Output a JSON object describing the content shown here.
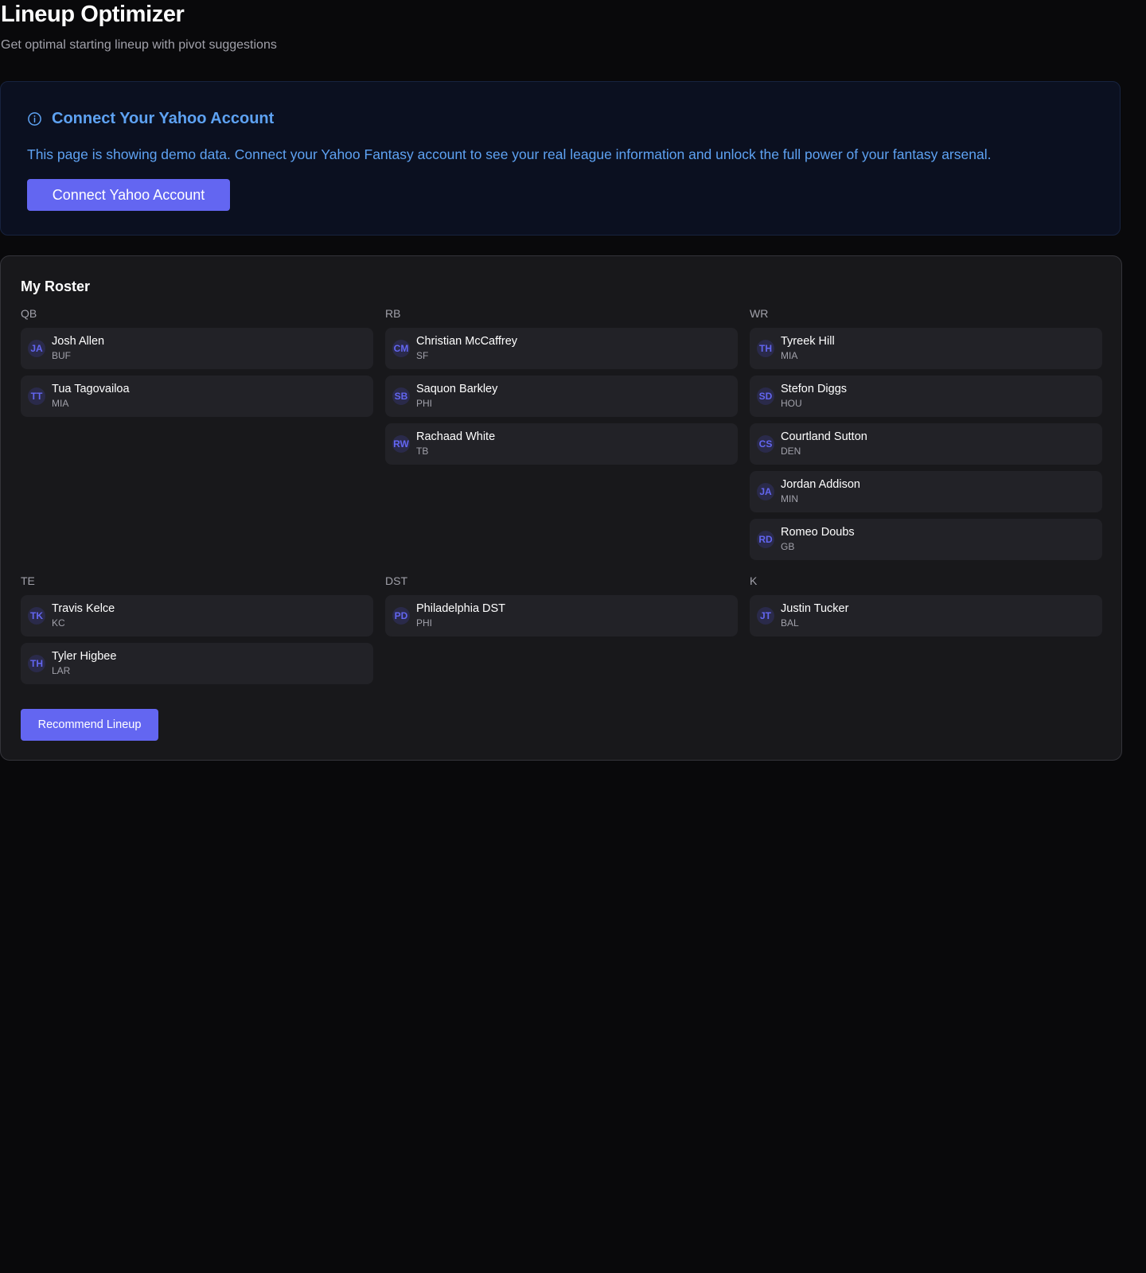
{
  "header": {
    "title": "Lineup Optimizer",
    "subtitle": "Get optimal starting lineup with pivot suggestions"
  },
  "notice": {
    "icon": "info-icon",
    "title": "Connect Your Yahoo Account",
    "text": "This page is showing demo data. Connect your Yahoo Fantasy account to see your real league information and unlock the full power of your fantasy arsenal.",
    "button_label": "Connect Yahoo Account",
    "accent_color": "#5ea2f2"
  },
  "roster": {
    "title": "My Roster",
    "recommend_label": "Recommend Lineup",
    "button_color": "#6366f1",
    "groups": [
      {
        "position": "QB",
        "players": [
          {
            "initials": "JA",
            "name": "Josh Allen",
            "team": "BUF"
          },
          {
            "initials": "TT",
            "name": "Tua Tagovailoa",
            "team": "MIA"
          }
        ]
      },
      {
        "position": "RB",
        "players": [
          {
            "initials": "CM",
            "name": "Christian McCaffrey",
            "team": "SF"
          },
          {
            "initials": "SB",
            "name": "Saquon Barkley",
            "team": "PHI"
          },
          {
            "initials": "RW",
            "name": "Rachaad White",
            "team": "TB"
          }
        ]
      },
      {
        "position": "WR",
        "players": [
          {
            "initials": "TH",
            "name": "Tyreek Hill",
            "team": "MIA"
          },
          {
            "initials": "SD",
            "name": "Stefon Diggs",
            "team": "HOU"
          },
          {
            "initials": "CS",
            "name": "Courtland Sutton",
            "team": "DEN"
          },
          {
            "initials": "JA",
            "name": "Jordan Addison",
            "team": "MIN"
          },
          {
            "initials": "RD",
            "name": "Romeo Doubs",
            "team": "GB"
          }
        ]
      },
      {
        "position": "TE",
        "players": [
          {
            "initials": "TK",
            "name": "Travis Kelce",
            "team": "KC"
          },
          {
            "initials": "TH",
            "name": "Tyler Higbee",
            "team": "LAR"
          }
        ]
      },
      {
        "position": "DST",
        "players": [
          {
            "initials": "PD",
            "name": "Philadelphia DST",
            "team": "PHI"
          }
        ]
      },
      {
        "position": "K",
        "players": [
          {
            "initials": "JT",
            "name": "Justin Tucker",
            "team": "BAL"
          }
        ]
      }
    ]
  }
}
